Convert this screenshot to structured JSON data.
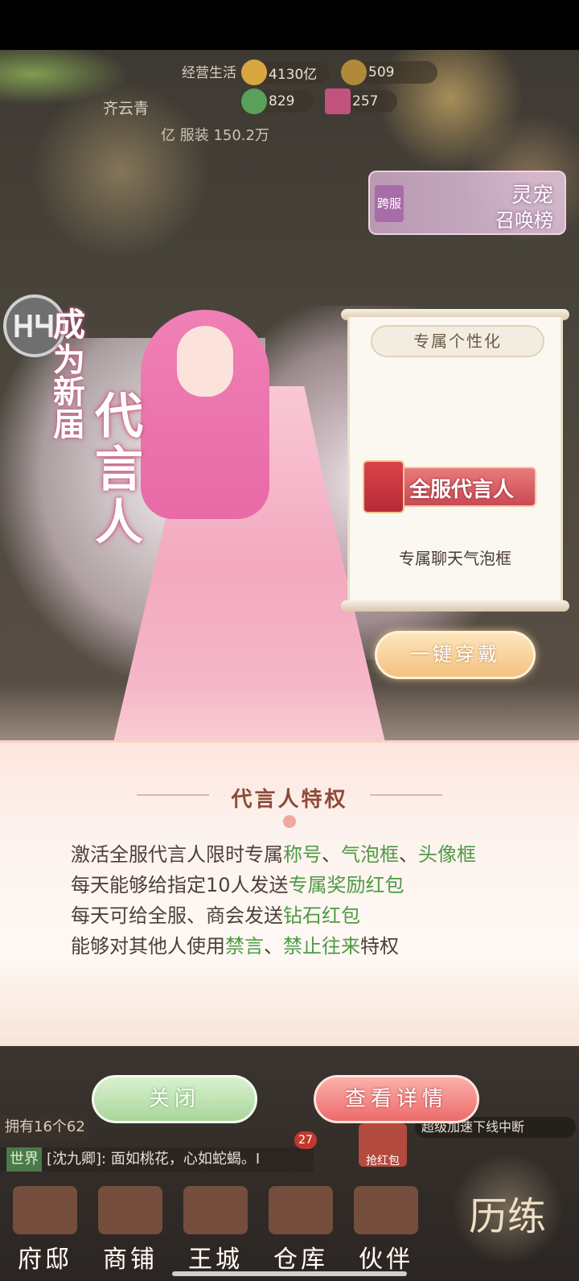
{
  "hud": {
    "gold": "4130亿",
    "ingots": "509",
    "top_label": "经营生活",
    "stamina": "829",
    "ticket": "257",
    "player_name": "齐云青",
    "power_line": "亿 服装 150.2万"
  },
  "event_banner": {
    "tag": "跨服",
    "title": "灵宠",
    "subtitle": "召唤榜"
  },
  "hero": {
    "title_small": [
      "成",
      "为",
      "新",
      "届"
    ],
    "title_big": [
      "代",
      "言",
      "人"
    ]
  },
  "scroll": {
    "header": "专属个性化",
    "badge_text": "全服代言人",
    "caption": "专属聊天气泡框"
  },
  "one_key_button": "一键穿戴",
  "privilege": {
    "title": "代言人特权",
    "lines": [
      {
        "plain": "激活全服代言人限时专属",
        "h1": "称号",
        "s1": "、",
        "h2": "气泡框",
        "s2": "、",
        "h3": "头像框"
      },
      {
        "plain": "每天能够给指定10人发送",
        "h1": "专属奖励红包"
      },
      {
        "plain": "每天可给全服、商会发送",
        "h1": "钻石红包"
      },
      {
        "plain": "能够对其他人使用",
        "h1": "禁言",
        "s1": "、",
        "h2": "禁止往来",
        "tail": "特权"
      }
    ]
  },
  "buttons": {
    "close": "关闭",
    "details": "查看详情"
  },
  "bottom": {
    "own_text": "拥有16个62",
    "chat_channel": "世界",
    "chat_text": "[沈九卿]: 面如桃花，心如蛇蝎。I",
    "chat_count": "27",
    "net_hint": "超级加速下线中断",
    "redpack_label": "抢红包",
    "nav": [
      "府邸",
      "商铺",
      "王城",
      "仓库",
      "伙伴"
    ],
    "practice": "历练"
  }
}
